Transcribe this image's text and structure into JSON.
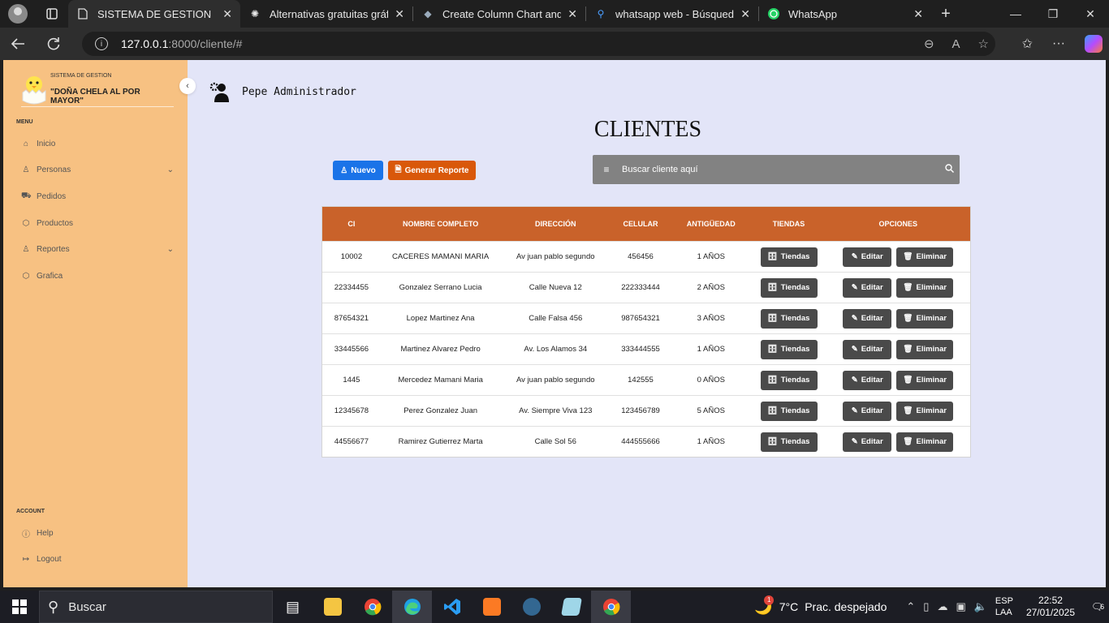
{
  "browser": {
    "tabs": [
      {
        "title": "SISTEMA DE GESTION",
        "icon": "page-icon",
        "active": true
      },
      {
        "title": "Alternativas gratuitas gráfica",
        "icon": "openai-icon",
        "active": false
      },
      {
        "title": "Create Column Chart and Gr",
        "icon": "chart-site-icon",
        "active": false
      },
      {
        "title": "whatsapp web - Búsqueda",
        "icon": "search-icon",
        "active": false
      },
      {
        "title": "WhatsApp",
        "icon": "whatsapp-icon",
        "active": false
      }
    ],
    "url_host": "127.0.0.1",
    "url_path": ":8000/cliente/#"
  },
  "sidebar": {
    "brand_small": "SISTEMA DE GESTION",
    "brand_name": "\"DOÑA CHELA AL POR MAYOR\"",
    "menu_label": "MENU",
    "items": [
      {
        "label": "Inicio",
        "icon": "home-icon"
      },
      {
        "label": "Personas",
        "icon": "user-icon",
        "has_submenu": true
      },
      {
        "label": "Pedidos",
        "icon": "truck-icon"
      },
      {
        "label": "Productos",
        "icon": "box-icon"
      },
      {
        "label": "Reportes",
        "icon": "user-icon",
        "has_submenu": true
      },
      {
        "label": "Grafica",
        "icon": "box-icon"
      }
    ],
    "account_label": "ACCOUNT",
    "account_items": [
      {
        "label": "Help",
        "icon": "help-icon"
      },
      {
        "label": "Logout",
        "icon": "logout-icon"
      }
    ]
  },
  "header": {
    "user_name": "Pepe Administrador"
  },
  "main": {
    "title": "CLIENTES",
    "new_button": "Nuevo",
    "report_button": "Generar Reporte",
    "search_placeholder": "Buscar cliente aquí",
    "columns": [
      "CI",
      "NOMBRE COMPLETO",
      "DIRECCIÓN",
      "CELULAR",
      "ANTIGÜEDAD",
      "TIENDAS",
      "OPCIONES"
    ],
    "rows": [
      {
        "ci": "10002",
        "nombre": "CACERES MAMANI MARIA",
        "direccion": "Av juan pablo segundo",
        "celular": "456456",
        "antiguedad": "1 AÑOS"
      },
      {
        "ci": "22334455",
        "nombre": "Gonzalez Serrano Lucia",
        "direccion": "Calle Nueva 12",
        "celular": "222333444",
        "antiguedad": "2 AÑOS"
      },
      {
        "ci": "87654321",
        "nombre": "Lopez Martinez Ana",
        "direccion": "Calle Falsa 456",
        "celular": "987654321",
        "antiguedad": "3 AÑOS"
      },
      {
        "ci": "33445566",
        "nombre": "Martinez Alvarez Pedro",
        "direccion": "Av. Los Alamos 34",
        "celular": "333444555",
        "antiguedad": "1 AÑOS"
      },
      {
        "ci": "1445",
        "nombre": "Mercedez Mamani Maria",
        "direccion": "Av juan pablo segundo",
        "celular": "142555",
        "antiguedad": "0 AÑOS"
      },
      {
        "ci": "12345678",
        "nombre": "Perez Gonzalez Juan",
        "direccion": "Av. Siempre Viva 123",
        "celular": "123456789",
        "antiguedad": "5 AÑOS"
      },
      {
        "ci": "44556677",
        "nombre": "Ramirez Gutierrez Marta",
        "direccion": "Calle Sol 56",
        "celular": "444555666",
        "antiguedad": "1 AÑOS"
      }
    ],
    "row_buttons": {
      "stores": "Tiendas",
      "edit": "Editar",
      "delete": "Eliminar"
    }
  },
  "taskbar": {
    "search_label": "Buscar",
    "weather_temp": "7°C",
    "weather_desc": "Prac. despejado",
    "weather_badge": "1",
    "lang_top": "ESP",
    "lang_bottom": "LAA",
    "time": "22:52",
    "date": "27/01/2025",
    "notification_count": "6"
  },
  "colors": {
    "sidebar_bg": "#f7c182",
    "page_bg": "#e3e5f8",
    "table_header": "#c9622a",
    "btn_new": "#1a73e8",
    "btn_report": "#d9580a",
    "row_button": "#4a4a4a"
  }
}
